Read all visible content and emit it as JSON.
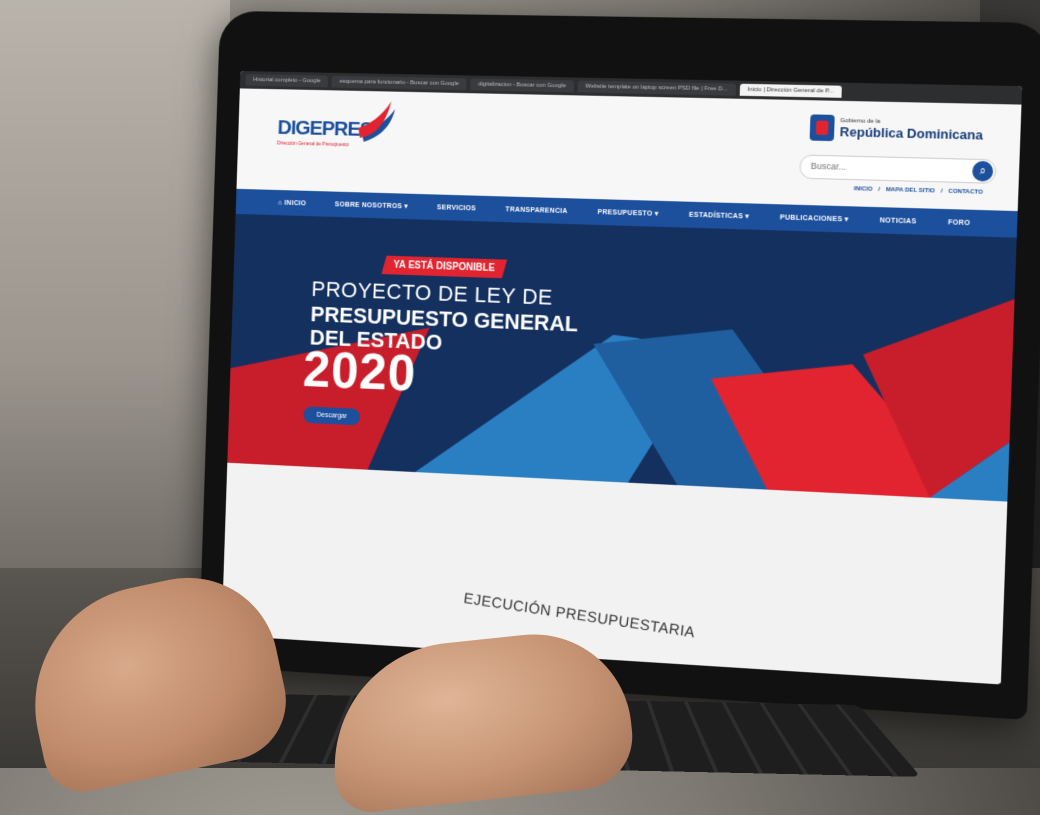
{
  "browser_tabs": [
    "Historial completo - Google",
    "esquema para funcionario - Buscar con Google",
    "digitalizacion - Buscar con Google",
    "Website template on laptop screen PSD file | Free D...",
    "Inicio | Dirección General de P..."
  ],
  "site": {
    "logo_text": "DIGEPRES",
    "logo_subtitle": "Dirección General de Presupuesto",
    "gov_small": "Gobierno de la",
    "gov_big": "República Dominicana",
    "search_placeholder": "Buscar...",
    "top_links": [
      "INICIO",
      "/",
      "MAPA DEL SITIO",
      "/",
      "CONTACTO"
    ]
  },
  "nav": [
    "⌂ INICIO",
    "SOBRE NOSOTROS ▾",
    "SERVICIOS",
    "TRANSPARENCIA",
    "PRESUPUESTO ▾",
    "ESTADÍSTICAS ▾",
    "PUBLICACIONES ▾",
    "NOTICIAS",
    "FORO"
  ],
  "hero": {
    "badge": "YA ESTÁ DISPONIBLE",
    "line1": "PROYECTO DE LEY DE",
    "line2": "PRESUPUESTO GENERAL",
    "line3": "DEL ESTADO",
    "year": "2020",
    "button": "Descargar"
  },
  "section_title": "EJECUCIÓN PRESUPUESTARIA",
  "colors": {
    "nav_blue": "#1c4f9c",
    "accent_red": "#e1242f",
    "hero_navy": "#14305f"
  }
}
